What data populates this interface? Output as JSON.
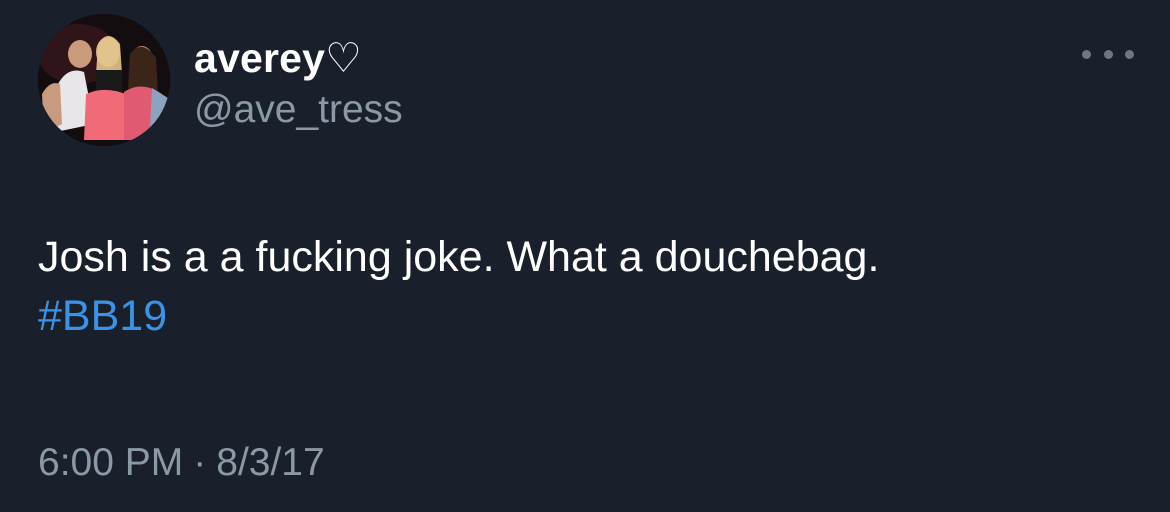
{
  "tweet": {
    "author": {
      "display_name": "averey♡",
      "handle": "@ave_tress",
      "avatar_icon": "profile-photo"
    },
    "more_icon": "more-options-icon",
    "text": "Josh is a a fucking joke. What a douchebag.",
    "hashtag": "#BB19",
    "time": "6:00 PM",
    "separator": "·",
    "date": "8/3/17",
    "colors": {
      "background": "#19202b",
      "text": "#ffffff",
      "secondary": "#8b98a5",
      "link": "#3a93e6"
    }
  }
}
